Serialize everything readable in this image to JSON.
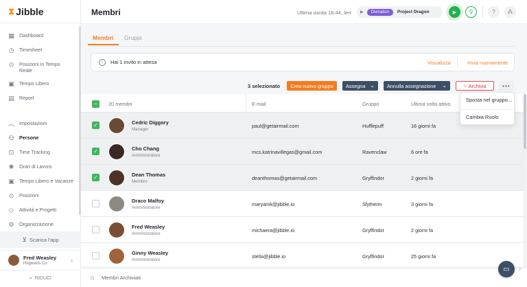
{
  "app": {
    "logo_mark": "⧗",
    "logo_text": "Jibble"
  },
  "sidebar": {
    "items": [
      {
        "label": "Dashboard",
        "icon": "dashboard-icon"
      },
      {
        "label": "Timesheet",
        "icon": "clock-icon"
      },
      {
        "label": "Posizioni in Tempo Reale",
        "icon": "location-pin-icon"
      },
      {
        "label": "Tempo Libero",
        "icon": "suitcase-icon"
      },
      {
        "label": "Report",
        "icon": "report-icon"
      }
    ],
    "settings_items": [
      {
        "label": "Impostazioni",
        "icon": "chevron-up-icon"
      },
      {
        "label": "Persone",
        "icon": "people-icon",
        "active": true
      },
      {
        "label": "Time Tracking",
        "icon": "time-tracking-icon"
      },
      {
        "label": "Orari di Lavoro",
        "icon": "work-schedule-icon"
      },
      {
        "label": "Tempo Libero e Vacanze",
        "icon": "suitcase-icon"
      },
      {
        "label": "Posizioni",
        "icon": "location-pin-icon"
      },
      {
        "label": "Attività e Progetti",
        "icon": "tag-icon"
      },
      {
        "label": "Organizzazione",
        "icon": "gear-icon"
      }
    ],
    "download_label": "Scarica l'app",
    "user": {
      "name": "Fred Weasley",
      "company": "Hogwarts Co"
    },
    "collapse_label": "RIDUCI"
  },
  "topbar": {
    "title": "Membri",
    "last_exit": "Ultima uscita 18:44, Ieri",
    "activity_tag": "Divination",
    "project_name": "Project Dragon"
  },
  "tabs": [
    {
      "label": "Membri",
      "active": true
    },
    {
      "label": "Gruppi",
      "active": false
    }
  ],
  "invite_banner": {
    "text": "Hai 1 invito in attesa",
    "view_label": "Visualizza",
    "resend_label": "Invia nuovamente"
  },
  "actions": {
    "selected_text": "3 selezionato",
    "new_group": "Crea nuovo gruppo",
    "assign": "Assegna",
    "unassign": "Annulla assegnazione",
    "archive": "Archivia",
    "more": "•••"
  },
  "dropdown_menu": {
    "items": [
      "Sposta nel gruppo...",
      "Cambia Ruolo"
    ]
  },
  "table": {
    "headers": {
      "members": "20 membri",
      "email": "E-mail",
      "group": "Gruppo",
      "last_active": "Ultima volta attivo"
    },
    "rows": [
      {
        "name": "Cedric Diggory",
        "role": "Manager",
        "email": "paul@getairmail.com",
        "group": "Hufflepuff",
        "last_active": "16 giorni fa",
        "selected": true,
        "avatar_color": "#6b4a34"
      },
      {
        "name": "Cho Chang",
        "role": "Amministratore",
        "email": "mcs.katrinavillegas@gmail.com",
        "group": "Ravenclaw",
        "last_active": "6 ore fa",
        "selected": true,
        "avatar_color": "#3a2a26"
      },
      {
        "name": "Dean Thomas",
        "role": "Membro",
        "email": "deanthomas@getairmail.com",
        "group": "Gryffindor",
        "last_active": "2 giorni fa",
        "selected": true,
        "avatar_color": "#4a3326"
      },
      {
        "name": "Draco Malfoy",
        "role": "Amministratore",
        "email": "maryamk@jibble.io",
        "group": "Slytherin",
        "last_active": "3 giorni fa",
        "selected": false,
        "avatar_color": "#8d8a84"
      },
      {
        "name": "Fred Weasley",
        "role": "Amministratore",
        "email": "michaera@jibble.io",
        "group": "Gryffindor",
        "last_active": "2 giorni fa",
        "selected": false,
        "avatar_color": "#7a4e32"
      },
      {
        "name": "Ginny Weasley",
        "role": "Amministratore",
        "email": "stella@jibble.io",
        "group": "Gryffindor",
        "last_active": "25 giorni fa",
        "selected": false,
        "avatar_color": "#a0623a"
      }
    ]
  },
  "footer": {
    "archived_label": "Membri Archiviati"
  },
  "colors": {
    "accent": "#f47c20",
    "green": "#22b14c",
    "navy": "#3d4f66",
    "danger": "#d93b3b",
    "purple": "#7d5bd9"
  }
}
